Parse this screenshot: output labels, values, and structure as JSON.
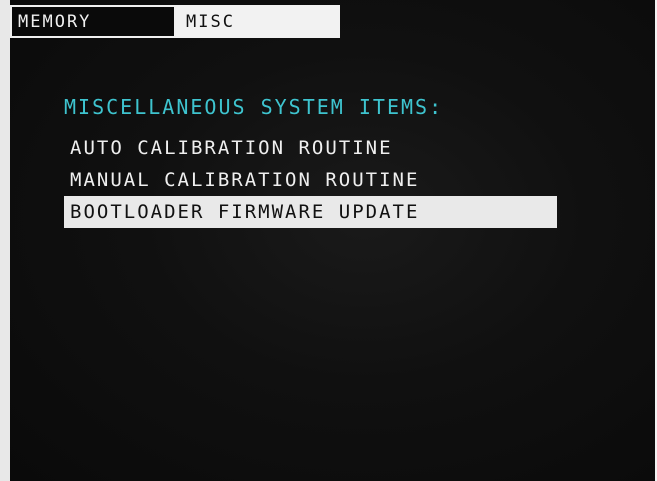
{
  "tabs": [
    {
      "label": "MEMORY",
      "active": false
    },
    {
      "label": "MISC",
      "active": true
    }
  ],
  "menu": {
    "title": "MISCELLANEOUS SYSTEM ITEMS:",
    "items": [
      {
        "label": "AUTO CALIBRATION ROUTINE",
        "selected": false
      },
      {
        "label": "MANUAL CALIBRATION ROUTINE",
        "selected": false
      },
      {
        "label": "BOOTLOADER FIRMWARE UPDATE",
        "selected": true
      }
    ]
  },
  "colors": {
    "background": "#0d0d0d",
    "title": "#3ec4cf",
    "text": "#efefef",
    "highlight": "#e9e9e9"
  }
}
